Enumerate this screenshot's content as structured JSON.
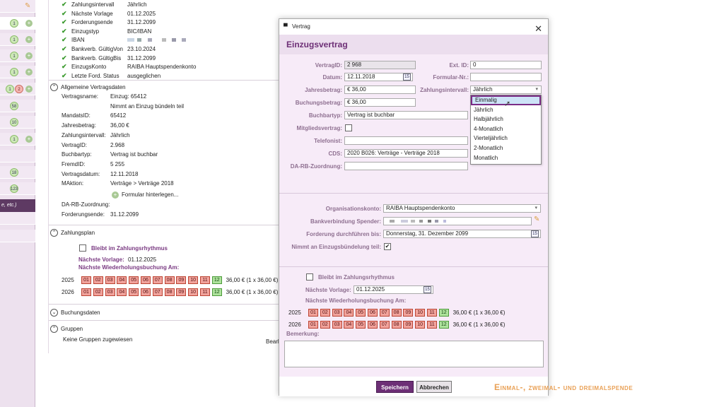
{
  "left_strip": {
    "rows": [
      {
        "badges": [],
        "plus": false
      },
      {
        "badges": [
          "1"
        ],
        "plus": true
      },
      {
        "badges": [
          "1"
        ],
        "plus": true
      },
      {
        "badges": [
          "1"
        ],
        "plus": true
      },
      {
        "badges": [
          "1"
        ],
        "plus": true
      },
      {
        "badges": [
          "1",
          "2"
        ],
        "plus": true
      },
      {
        "badges": [
          "58"
        ],
        "plus": false
      },
      {
        "badges": [
          "10"
        ],
        "plus": false
      },
      {
        "badges": [
          "1"
        ],
        "plus": true
      },
      {
        "badges": [
          "18"
        ],
        "plus": false
      },
      {
        "badges": [
          "123"
        ],
        "plus": false
      }
    ],
    "active_item": "e, etc.)"
  },
  "summary": [
    {
      "label": "Zahlungsintervall",
      "value": "Jährlich"
    },
    {
      "label": "Nächste Vorlage",
      "value": "01.12.2025"
    },
    {
      "label": "Forderungsende",
      "value": "31.12.2099"
    },
    {
      "label": "Einzugstyp",
      "value": "BIC/IBAN"
    },
    {
      "label": "IBAN",
      "value": ""
    },
    {
      "label": "Bankverb. GültigVon",
      "value": "23.10.2024"
    },
    {
      "label": "Bankverb. GültigBis",
      "value": "31.12.2099"
    },
    {
      "label": "EinzugsKonto",
      "value": "RAIBA Hauptspendenkonto"
    },
    {
      "label": "Letzte Ford. Status",
      "value": "ausgeglichen"
    }
  ],
  "contract_section": {
    "title": "Allgemeine Vertragsdaten",
    "rows": [
      {
        "label": "Vertragsname:",
        "value": "Einzug: 65412"
      },
      {
        "label": "",
        "value": "Nimmt an Einzug bündeln teil"
      },
      {
        "label": "MandatsID:",
        "value": "65412"
      },
      {
        "label": "Jahresbetrag:",
        "value": "36,00 €"
      },
      {
        "label": "Zahlungsintervall:",
        "value": "Jährlich"
      },
      {
        "label": "VertragID:",
        "value": "2.968"
      },
      {
        "label": "Buchbartyp:",
        "value": "Vertrag ist buchbar"
      },
      {
        "label": "FremdID:",
        "value": "5 255"
      },
      {
        "label": "Vertragsdatum:",
        "value": "12.11.2018"
      },
      {
        "label": "MAktion:",
        "value": "Verträge  >  Verträge 2018"
      }
    ],
    "form_link": "Formular hinterlegen...",
    "rows2": [
      {
        "label": "DA-RB-Zuordnung:",
        "value": ""
      },
      {
        "label": "Forderungsende:",
        "value": "31.12.2099"
      }
    ]
  },
  "plan_section": {
    "title": "Zahlungsplan",
    "checkbox_label": "Bleibt im Zahlungsrhythmus",
    "next_template_label": "Nächste Vorlage:",
    "next_template_value": "01.12.2025",
    "next_repeat_label": "Nächste Wiederholungsbuchung Am:",
    "years": [
      {
        "year": "2025",
        "months": [
          "01",
          "02",
          "03",
          "04",
          "05",
          "06",
          "07",
          "08",
          "09",
          "10",
          "11",
          "12"
        ],
        "green": [
          12
        ],
        "sum": "36,00 € (1 x 36,00 €)"
      },
      {
        "year": "2026",
        "months": [
          "01",
          "02",
          "03",
          "04",
          "05",
          "06",
          "07",
          "08",
          "09",
          "10",
          "11",
          "12"
        ],
        "green": [
          12
        ],
        "sum": "36,00 € (1 x 36,00 €)"
      }
    ]
  },
  "booking_section": {
    "title": "Buchungsdaten"
  },
  "groups_section": {
    "title": "Gruppen",
    "text": "Keine Gruppen zugewiesen",
    "cut_button": "Bearl"
  },
  "dialog": {
    "window_title": "Vertrag",
    "heading": "Einzugsvertrag",
    "fields": {
      "vertragid_label": "VertragID:",
      "vertragid": "2 968",
      "extid_label": "Ext. ID:",
      "extid": "0",
      "datum_label": "Datum:",
      "datum": "12.11.2018",
      "formular_label": "Formular-Nr.:",
      "formular": "",
      "jahresbetrag_label": "Jahresbetrag:",
      "jahresbetrag": "€ 36,00",
      "intervall_label": "Zahlungsintervall:",
      "intervall": "Jährlich",
      "buchungsbetrag_label": "Buchungsbetrag:",
      "buchungsbetrag": "€ 36,00",
      "buchbartyp_label": "Buchbartyp:",
      "buchbartyp": "Vertrag ist buchbar",
      "mitglied_label": "Mitgliedsvertrag:",
      "telefonist_label": "Telefonist:",
      "telefonist": "",
      "cds_label": "CDS:",
      "cds": "2020 B026: Verträge - Verträge 2018",
      "darb_label": "DA-RB-Zuordnung:",
      "darb": "",
      "orgkonto_label": "Organisationskonto:",
      "orgkonto": "RAIBA Hauptspendenkonto",
      "bank_label": "Bankverbindung Spender:",
      "forderung_label": "Forderung durchführen bis:",
      "forderung": "Donnerstag, 31. Dezember 2099",
      "buendel_label": "Nimmt an Einzugsbündelung teil:",
      "rhythmus_label": "Bleibt im Zahlungsrhythmus",
      "vorlage_label": "Nächste Vorlage:",
      "vorlage": "01.12.2025",
      "wiederholung_label": "Nächste Wiederholungsbuchung Am:",
      "bemerkung_label": "Bemerkung:"
    },
    "years": [
      {
        "year": "2025",
        "months": [
          "01",
          "02",
          "03",
          "04",
          "05",
          "06",
          "07",
          "08",
          "09",
          "10",
          "11",
          "12"
        ],
        "sum": "36,00 € (1 x 36,00 €)"
      },
      {
        "year": "2026",
        "months": [
          "01",
          "02",
          "03",
          "04",
          "05",
          "06",
          "07",
          "08",
          "09",
          "10",
          "11",
          "12"
        ],
        "sum": "36,00 € (1 x 36,00 €)"
      }
    ],
    "dropdown_options": [
      "Einmalig",
      "Jährlich",
      "Halbjährlich",
      "4-Monatlich",
      "Vierteljährlich",
      "2-Monatlich",
      "Monatlich"
    ],
    "dropdown_highlight": "Einmalig",
    "calendar_icon_text": "15",
    "save_label": "Speichern",
    "cancel_label": "Abbrechen"
  },
  "caption": "Einmal-, zweimal- und dreimalspende",
  "colors": {
    "accent": "#6d2f76",
    "panel": "#f7ebf8",
    "caption": "#e9a055",
    "check": "#3a9a2d"
  }
}
